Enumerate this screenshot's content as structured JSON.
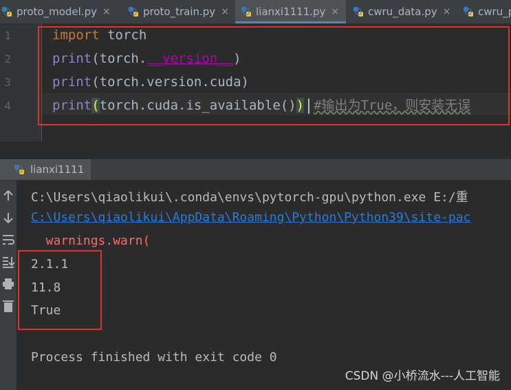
{
  "tabs": [
    {
      "label": "proto_model.py",
      "active": false
    },
    {
      "label": "proto_train.py",
      "active": false
    },
    {
      "label": "lianxi1111.py",
      "active": true
    },
    {
      "label": "cwru_data.py",
      "active": false
    },
    {
      "label": "cwru_p",
      "active": false
    }
  ],
  "close_glyph": "×",
  "editor": {
    "line_numbers": [
      "1",
      "2",
      "3",
      "4"
    ],
    "lines": [
      {
        "kw": "import",
        "rest": " torch"
      },
      {
        "fn": "print",
        "a": "(torch.",
        "magic": "__version__",
        "b": ")"
      },
      {
        "fn": "print",
        "a": "(torch.version.cuda)"
      },
      {
        "fn": "print",
        "p1": "(",
        "a": "torch.cuda.is_available()",
        "p2": ")",
        "comment": "#输出为True，则安装无误"
      }
    ]
  },
  "run": {
    "tab_label": "lianxi1111",
    "output": [
      "C:\\Users\\qiaolikui\\.conda\\envs\\pytorch-gpu\\python.exe E:/重",
      "C:\\Users\\qiaolikui\\AppData\\Roaming\\Python\\Python39\\site-pac",
      "  warnings.warn(",
      "2.1.1",
      "11.8",
      "True",
      "Process finished with exit code 0"
    ]
  },
  "watermark": "CSDN @小桥流水---人工智能",
  "colors": {
    "highlight_box": "#e0322a",
    "accent": "#4a88c7"
  }
}
